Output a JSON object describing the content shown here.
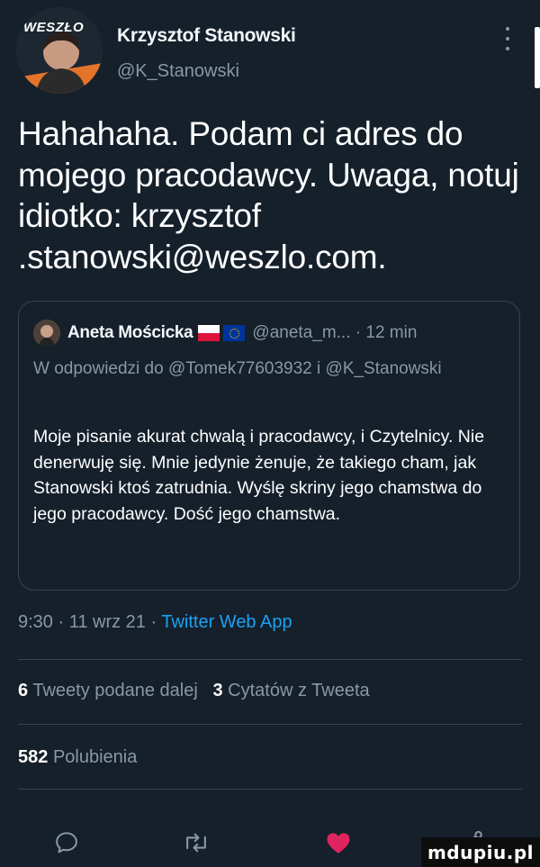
{
  "author": {
    "avatar_text": "WESZŁO",
    "name": "Krzysztof Stanowski",
    "handle": "@K_Stanowski"
  },
  "tweet": {
    "text": "Hahahaha. Podam ci adres do mojego pracodawcy. Uwaga, notuj idiotko: krzysztof .stanowski@weszlo.com."
  },
  "quote": {
    "name": "Aneta Mościcka",
    "handle_time": "@aneta_m... · 12 min",
    "reply_to": "W odpowiedzi do @Tomek77603932 i @K_Stanowski",
    "text": "Moje pisanie akurat chwalą i pracodawcy, i Czytelnicy. Nie denerwuję się. Mnie jedynie żenuje, że takiego cham, jak Stanowski ktoś zatrudnia. Wyślę skriny jego chamstwa do jego pracodawcy. Dość jego chamstwa."
  },
  "meta": {
    "time_date": "9:30 · 11 wrz 21 · ",
    "app": "Twitter Web App"
  },
  "stats": {
    "retweets_count": "6",
    "retweets_label": "Tweety podane dalej",
    "quotes_count": "3",
    "quotes_label": "Cytatów z Tweeta",
    "likes_count": "582",
    "likes_label": "Polubienia"
  },
  "actions": {
    "reply_icon": "comment-icon",
    "retweet_icon": "retweet-icon",
    "like_icon": "heart-icon",
    "share_icon": "share-icon"
  },
  "watermark": "mdupiu.pl",
  "colors": {
    "background": "#15202b",
    "secondary_text": "#8899a6",
    "link": "#1da1f2",
    "like": "#e0245e",
    "border": "#38444d"
  }
}
